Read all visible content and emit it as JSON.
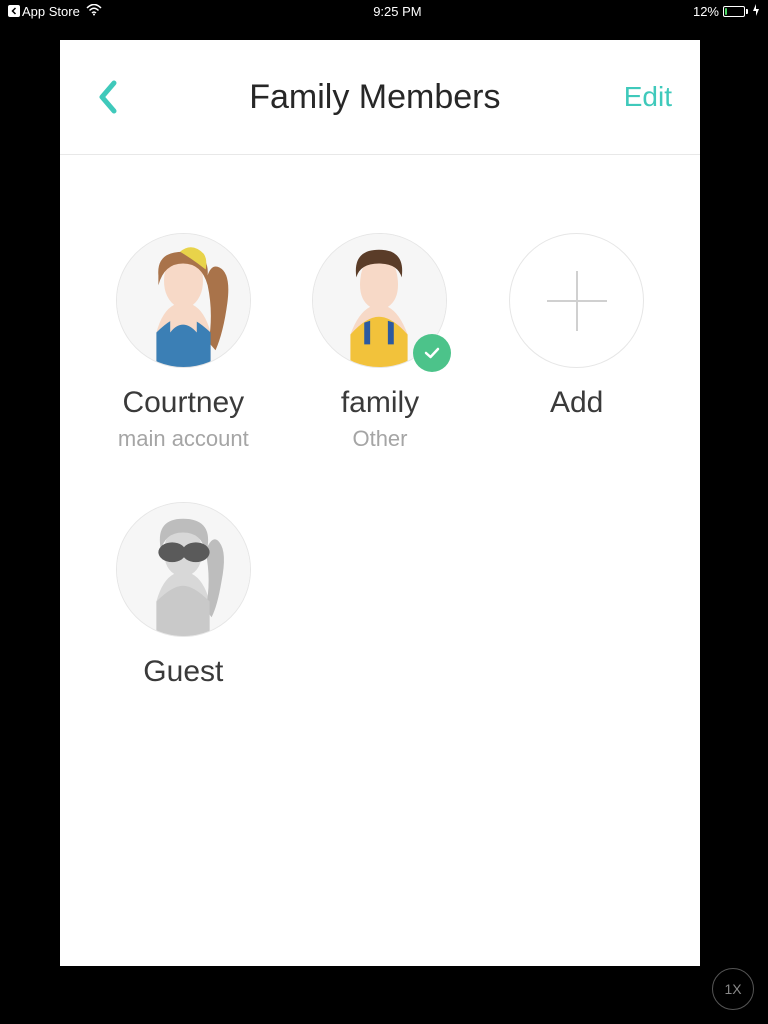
{
  "status": {
    "back_label": "App Store",
    "time": "9:25 PM",
    "battery_pct": "12%"
  },
  "nav": {
    "title": "Family Members",
    "edit": "Edit"
  },
  "members": [
    {
      "name": "Courtney",
      "sub": "main account"
    },
    {
      "name": "family",
      "sub": "Other"
    },
    {
      "name": "Add",
      "sub": ""
    },
    {
      "name": "Guest",
      "sub": ""
    }
  ],
  "overlay": {
    "scale": "1X"
  },
  "colors": {
    "accent": "#3fc9bb",
    "check": "#4cc38a"
  }
}
